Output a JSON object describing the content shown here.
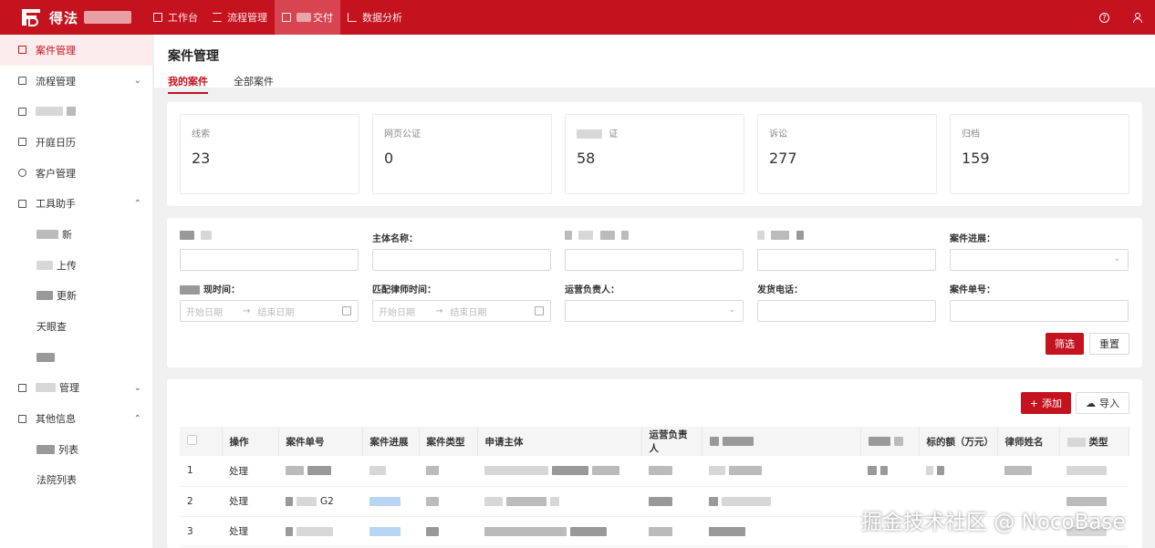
{
  "app": {
    "brand": "得法",
    "colors": {
      "primary": "#c4121f",
      "primary_light": "#fdecec"
    }
  },
  "topnav": {
    "items": [
      {
        "label": "工作台",
        "icon": "monitor-icon"
      },
      {
        "label": "流程管理",
        "icon": "list-icon"
      },
      {
        "label": "交付",
        "icon": "grid-icon",
        "active": true
      },
      {
        "label": "数据分析",
        "icon": "chart-icon"
      }
    ],
    "help_icon": "?",
    "user_icon": "user-icon"
  },
  "sidebar": {
    "items": [
      {
        "label": "案件管理",
        "icon": "grid-icon",
        "active": true
      },
      {
        "label": "流程管理",
        "icon": "list-icon",
        "chevron": "⌄"
      },
      {
        "label": "",
        "icon": "monitor-icon"
      },
      {
        "label": "开庭日历",
        "icon": "calendar-icon"
      },
      {
        "label": "客户管理",
        "icon": "users-icon"
      },
      {
        "label": "工具助手",
        "icon": "toolbox-icon",
        "chevron": "⌃"
      }
    ],
    "tool_subitems": [
      {
        "label": "新"
      },
      {
        "label": "上传"
      },
      {
        "label": "更新"
      },
      {
        "label": "天眼查"
      },
      {
        "label": ""
      }
    ],
    "more_items": [
      {
        "label": "管理",
        "icon": "id-card-icon",
        "chevron": "⌄"
      },
      {
        "label": "其他信息",
        "icon": "table-icon",
        "chevron": "⌃"
      }
    ],
    "other_subitems": [
      {
        "label": "列表"
      },
      {
        "label": "法院列表"
      }
    ]
  },
  "page": {
    "title": "案件管理",
    "tabs": [
      {
        "label": "我的案件",
        "active": true
      },
      {
        "label": "全部案件"
      }
    ]
  },
  "stats": [
    {
      "label": "线索",
      "value": "23"
    },
    {
      "label": "网页公证",
      "value": "0"
    },
    {
      "label": "证",
      "value": "58"
    },
    {
      "label": "诉讼",
      "value": "277"
    },
    {
      "label": "归档",
      "value": "159"
    }
  ],
  "filters": {
    "row1": [
      {
        "label": "",
        "type": "text"
      },
      {
        "label": "主体名称：",
        "type": "text"
      },
      {
        "label": "",
        "type": "text"
      },
      {
        "label": "",
        "type": "text"
      },
      {
        "label": "案件进展：",
        "type": "select"
      }
    ],
    "row2": [
      {
        "label": "现时间：",
        "type": "range",
        "start": "开始日期",
        "end": "结束日期"
      },
      {
        "label": "匹配律师时间：",
        "type": "range",
        "start": "开始日期",
        "end": "结束日期"
      },
      {
        "label": "运营负责人：",
        "type": "select"
      },
      {
        "label": "发货电话：",
        "type": "text"
      },
      {
        "label": "案件单号：",
        "type": "text"
      }
    ],
    "submit_label": "筛选",
    "reset_label": "重置"
  },
  "table": {
    "add_label": "添加",
    "import_label": "导入",
    "columns": [
      "操作",
      "案件单号",
      "案件进展",
      "案件类型",
      "申请主体",
      "运营负责人",
      "",
      "",
      "标的额（万元）",
      "律师姓名",
      "类型"
    ],
    "rows": [
      {
        "index": "1",
        "action": "处理",
        "case_no": ""
      },
      {
        "index": "2",
        "action": "处理",
        "case_no": "G2"
      },
      {
        "index": "3",
        "action": "处理",
        "case_no": ""
      }
    ]
  },
  "watermark": "掘金技术社区 @ NocoBase"
}
